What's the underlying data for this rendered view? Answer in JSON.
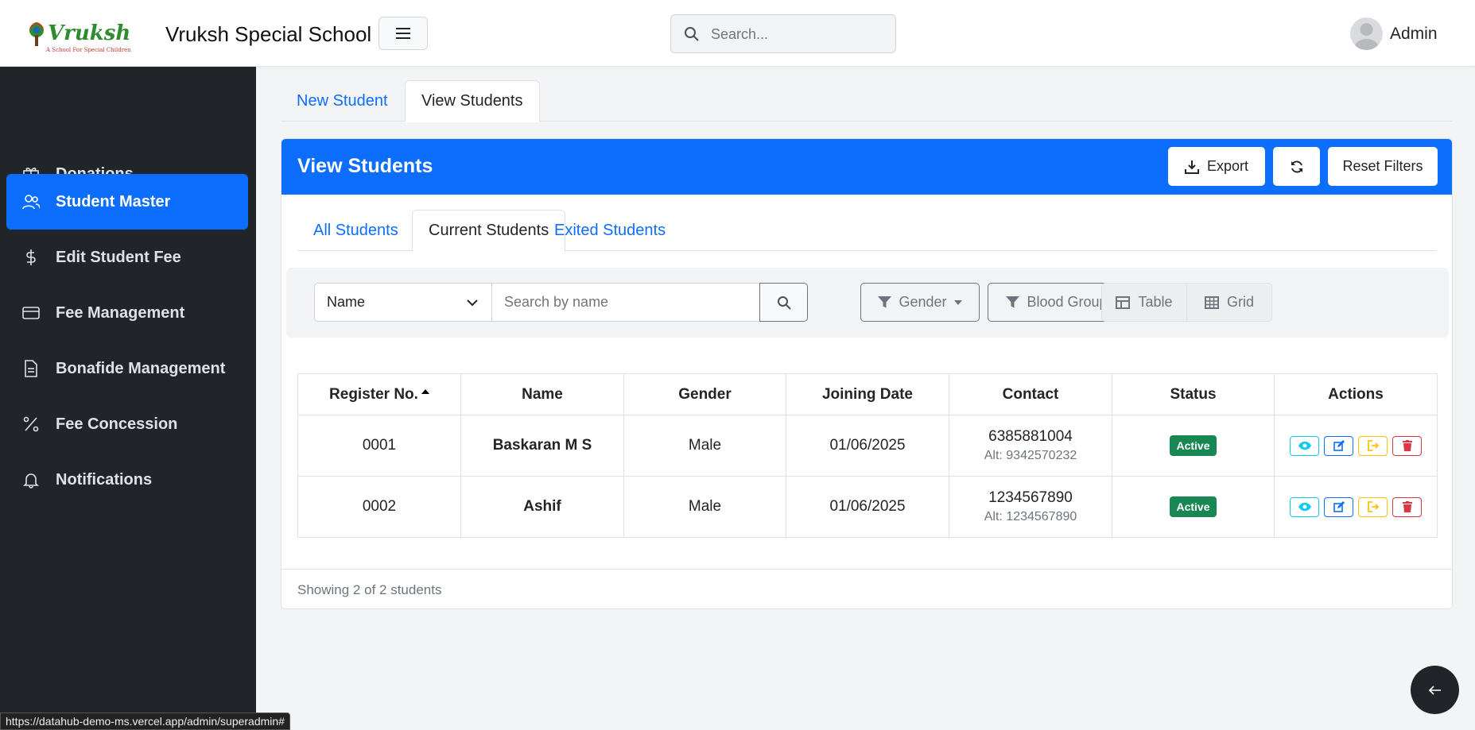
{
  "app": {
    "title": "Vruksh Special School",
    "logo_text": "Vruksh",
    "logo_tagline": "A School For Special Children"
  },
  "header": {
    "search_placeholder": "Search...",
    "user_name": "Admin"
  },
  "sidebar": {
    "items": [
      {
        "label": "Donations",
        "icon": "gift-icon",
        "active": false
      },
      {
        "label": "Student Master",
        "icon": "users-icon",
        "active": true
      },
      {
        "label": "Edit Student Fee",
        "icon": "dollar-icon",
        "active": false
      },
      {
        "label": "Fee Management",
        "icon": "credit-card-icon",
        "active": false
      },
      {
        "label": "Bonafide Management",
        "icon": "document-icon",
        "active": false
      },
      {
        "label": "Fee Concession",
        "icon": "percent-icon",
        "active": false
      },
      {
        "label": "Notifications",
        "icon": "bell-icon",
        "active": false
      }
    ]
  },
  "main_tabs": [
    {
      "label": "New Student",
      "active": false
    },
    {
      "label": "View Students",
      "active": true
    }
  ],
  "card": {
    "title": "View Students",
    "export_label": "Export",
    "reset_label": "Reset Filters"
  },
  "sub_tabs": [
    {
      "label": "All Students",
      "active": false
    },
    {
      "label": "Current Students",
      "active": true
    },
    {
      "label": "Exited Students",
      "active": false
    }
  ],
  "filters": {
    "field_select": "Name",
    "search_placeholder": "Search by name",
    "gender_label": "Gender",
    "blood_group_label": "Blood Group",
    "table_label": "Table",
    "grid_label": "Grid"
  },
  "table": {
    "columns": [
      "Register No.",
      "Name",
      "Gender",
      "Joining Date",
      "Contact",
      "Status",
      "Actions"
    ],
    "rows": [
      {
        "reg": "0001",
        "name": "Baskaran M S",
        "gender": "Male",
        "joining": "01/06/2025",
        "contact": "6385881004",
        "alt": "Alt: 9342570232",
        "status": "Active"
      },
      {
        "reg": "0002",
        "name": "Ashif",
        "gender": "Male",
        "joining": "01/06/2025",
        "contact": "1234567890",
        "alt": "Alt: 1234567890",
        "status": "Active"
      }
    ]
  },
  "footer": {
    "summary": "Showing 2 of 2 students"
  },
  "status_bar_url": "https://datahub-demo-ms.vercel.app/admin/superadmin#",
  "colors": {
    "primary": "#0d6efd",
    "sidebar_bg": "#212529",
    "success": "#198754",
    "info": "#0dcaf0",
    "warning": "#ffc107",
    "danger": "#dc3545"
  }
}
